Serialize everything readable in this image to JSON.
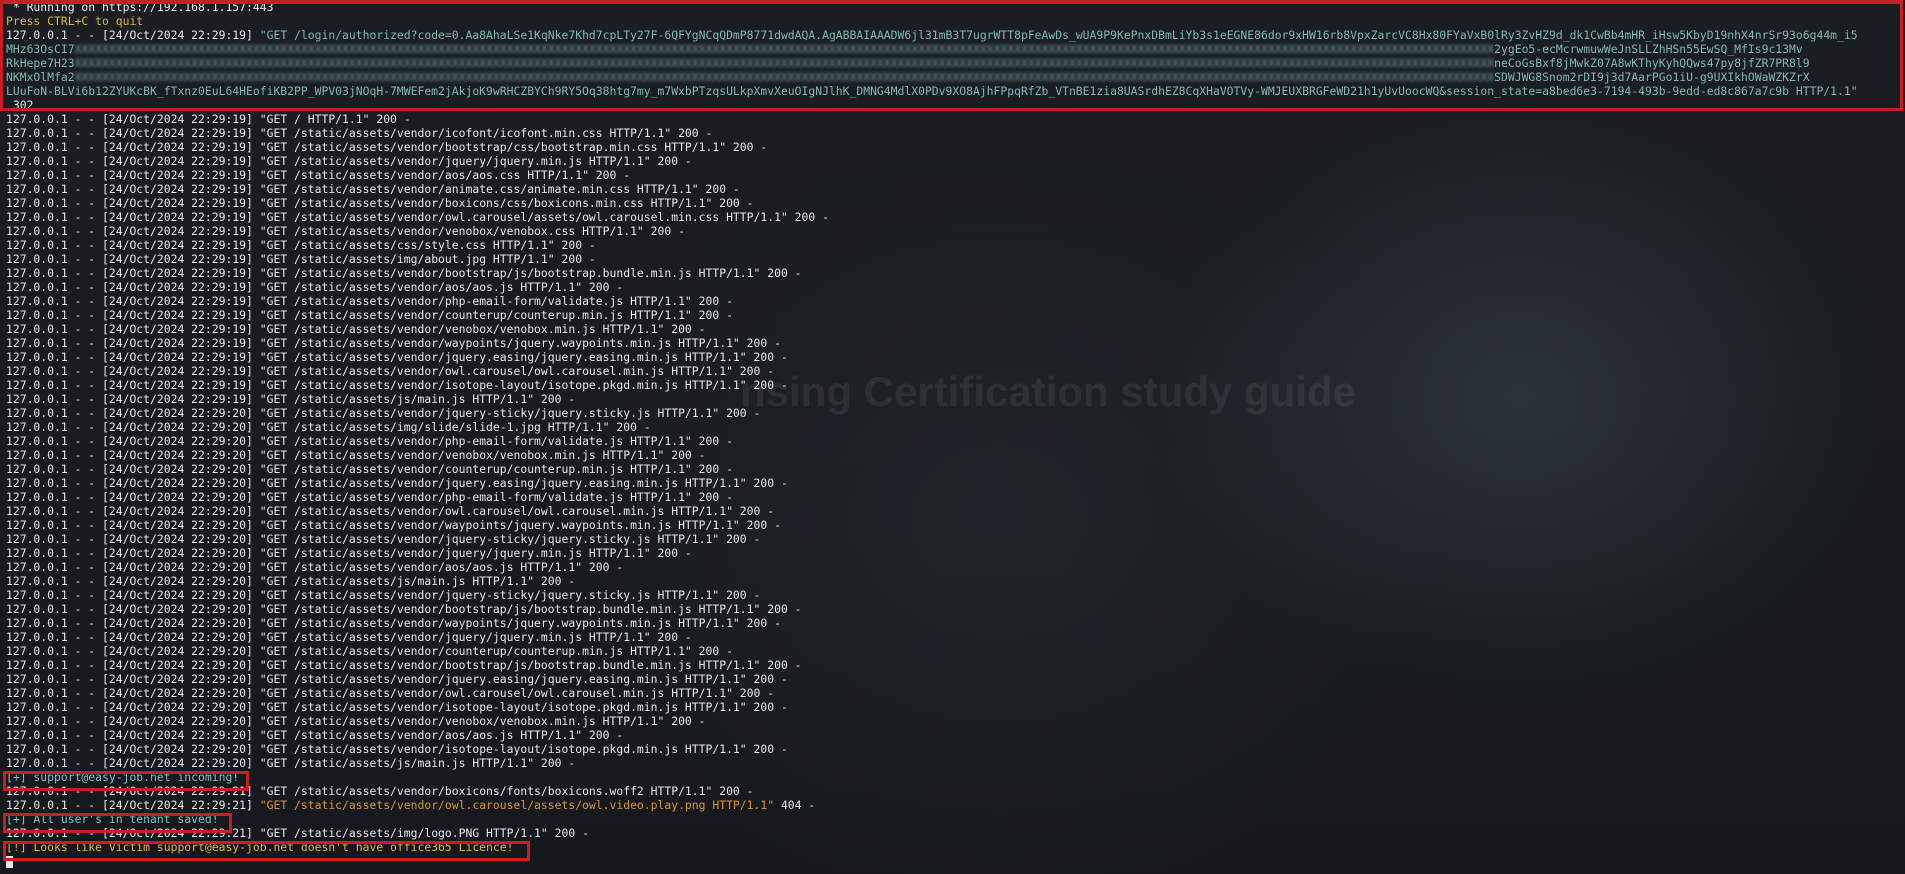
{
  "header": {
    "running": " * Running on https://192.168.1.157:443",
    "quit_hint": "Press CTRL+C to quit"
  },
  "auth_request": {
    "prefix": "127.0.0.1 - - [24/Oct/2024 22:29:19] ",
    "line1": "\"GET /login/authorized?code=0.Aa8AhaLSe1KqNke7Khd7cpLTy27F-6QFYgNCqQDmP8771dwdAQA.AgABBAIAAADW6jl31mB3T7ugrWTT8pFeAwDs_wUA9P9KePnxDBmLiYb3s1eEGNE86dor9xHW16rb8VpxZarcVC8Hx80FYaVxB0lRy3ZvHZ9d_dk1CwBb4mHR_iHsw5KbyD19nhX4nrSr93o6g44m_i5",
    "line2_start": "MHz63OsCI7",
    "line2_end": "2ygEo5-ecMcrwmuwWeJnSLLZhHSn55EwSQ_MfIs9c13Mv",
    "line3_start": "RkHepe7H23",
    "line3_end": "neCoGsBxf8jMwkZ07A8wKThyKyhQQws47py8jfZR7PR8l9",
    "line4_start": "NKMxOlMfa2",
    "line4_end": "SDWJWG8Snom2rDI9j3d7AarPGo1iU-g9UXIkhOWaWZKZrX",
    "line5": "LUuFoN-BLVi6b12ZYUKcBK_fTxnz0EuL64HEofiKB2PP_WPV03jNOqH-7MWEFem2jAkjoK9wRHCZBYCh9RY5Oq38htg7my_m7WxbPTzqsULkpXmvXeuOIgNJlhK_DMNG4MdlX0PDv9XO8AjhFPpqRfZb_VTnBE1zia8UASrdhEZ8CqXHaVOTVy-WMJEUXBRGFeWD21h1yUvUoocWQ&session_state=a8bed6e3-7194-493b-9edd-ed8c867a7c9b HTTP/1.1\"",
    "status": " 302"
  },
  "log_prefix_19": "127.0.0.1 - - [24/Oct/2024 22:29:19] ",
  "log_prefix_20": "127.0.0.1 - - [24/Oct/2024 22:29:20] ",
  "log_prefix_21": "127.0.0.1 - - [24/Oct/2024 22:29:21] ",
  "log_lines": [
    {
      "ts": "19",
      "req": "\"GET / HTTP/1.1\" 200 -"
    },
    {
      "ts": "19",
      "req": "\"GET /static/assets/vendor/icofont/icofont.min.css HTTP/1.1\" 200 -"
    },
    {
      "ts": "19",
      "req": "\"GET /static/assets/vendor/bootstrap/css/bootstrap.min.css HTTP/1.1\" 200 -"
    },
    {
      "ts": "19",
      "req": "\"GET /static/assets/vendor/jquery/jquery.min.js HTTP/1.1\" 200 -"
    },
    {
      "ts": "19",
      "req": "\"GET /static/assets/vendor/aos/aos.css HTTP/1.1\" 200 -"
    },
    {
      "ts": "19",
      "req": "\"GET /static/assets/vendor/animate.css/animate.min.css HTTP/1.1\" 200 -"
    },
    {
      "ts": "19",
      "req": "\"GET /static/assets/vendor/boxicons/css/boxicons.min.css HTTP/1.1\" 200 -"
    },
    {
      "ts": "19",
      "req": "\"GET /static/assets/vendor/owl.carousel/assets/owl.carousel.min.css HTTP/1.1\" 200 -"
    },
    {
      "ts": "19",
      "req": "\"GET /static/assets/vendor/venobox/venobox.css HTTP/1.1\" 200 -"
    },
    {
      "ts": "19",
      "req": "\"GET /static/assets/css/style.css HTTP/1.1\" 200 -"
    },
    {
      "ts": "19",
      "req": "\"GET /static/assets/img/about.jpg HTTP/1.1\" 200 -"
    },
    {
      "ts": "19",
      "req": "\"GET /static/assets/vendor/bootstrap/js/bootstrap.bundle.min.js HTTP/1.1\" 200 -"
    },
    {
      "ts": "19",
      "req": "\"GET /static/assets/vendor/aos/aos.js HTTP/1.1\" 200 -"
    },
    {
      "ts": "19",
      "req": "\"GET /static/assets/vendor/php-email-form/validate.js HTTP/1.1\" 200 -"
    },
    {
      "ts": "19",
      "req": "\"GET /static/assets/vendor/counterup/counterup.min.js HTTP/1.1\" 200 -"
    },
    {
      "ts": "19",
      "req": "\"GET /static/assets/vendor/venobox/venobox.min.js HTTP/1.1\" 200 -"
    },
    {
      "ts": "19",
      "req": "\"GET /static/assets/vendor/waypoints/jquery.waypoints.min.js HTTP/1.1\" 200 -"
    },
    {
      "ts": "19",
      "req": "\"GET /static/assets/vendor/jquery.easing/jquery.easing.min.js HTTP/1.1\" 200 -"
    },
    {
      "ts": "19",
      "req": "\"GET /static/assets/vendor/owl.carousel/owl.carousel.min.js HTTP/1.1\" 200 -"
    },
    {
      "ts": "19",
      "req": "\"GET /static/assets/vendor/isotope-layout/isotope.pkgd.min.js HTTP/1.1\" 200 -"
    },
    {
      "ts": "19",
      "req": "\"GET /static/assets/js/main.js HTTP/1.1\" 200 -"
    },
    {
      "ts": "20",
      "req": "\"GET /static/assets/vendor/jquery-sticky/jquery.sticky.js HTTP/1.1\" 200 -"
    },
    {
      "ts": "20",
      "req": "\"GET /static/assets/img/slide/slide-1.jpg HTTP/1.1\" 200 -"
    },
    {
      "ts": "20",
      "req": "\"GET /static/assets/vendor/php-email-form/validate.js HTTP/1.1\" 200 -"
    },
    {
      "ts": "20",
      "req": "\"GET /static/assets/vendor/venobox/venobox.min.js HTTP/1.1\" 200 -"
    },
    {
      "ts": "20",
      "req": "\"GET /static/assets/vendor/counterup/counterup.min.js HTTP/1.1\" 200 -"
    },
    {
      "ts": "20",
      "req": "\"GET /static/assets/vendor/jquery.easing/jquery.easing.min.js HTTP/1.1\" 200 -"
    },
    {
      "ts": "20",
      "req": "\"GET /static/assets/vendor/php-email-form/validate.js HTTP/1.1\" 200 -"
    },
    {
      "ts": "20",
      "req": "\"GET /static/assets/vendor/owl.carousel/owl.carousel.min.js HTTP/1.1\" 200 -"
    },
    {
      "ts": "20",
      "req": "\"GET /static/assets/vendor/waypoints/jquery.waypoints.min.js HTTP/1.1\" 200 -"
    },
    {
      "ts": "20",
      "req": "\"GET /static/assets/vendor/jquery-sticky/jquery.sticky.js HTTP/1.1\" 200 -"
    },
    {
      "ts": "20",
      "req": "\"GET /static/assets/vendor/jquery/jquery.min.js HTTP/1.1\" 200 -"
    },
    {
      "ts": "20",
      "req": "\"GET /static/assets/vendor/aos/aos.js HTTP/1.1\" 200 -"
    },
    {
      "ts": "20",
      "req": "\"GET /static/assets/js/main.js HTTP/1.1\" 200 -"
    },
    {
      "ts": "20",
      "req": "\"GET /static/assets/vendor/jquery-sticky/jquery.sticky.js HTTP/1.1\" 200 -"
    },
    {
      "ts": "20",
      "req": "\"GET /static/assets/vendor/bootstrap/js/bootstrap.bundle.min.js HTTP/1.1\" 200 -"
    },
    {
      "ts": "20",
      "req": "\"GET /static/assets/vendor/waypoints/jquery.waypoints.min.js HTTP/1.1\" 200 -"
    },
    {
      "ts": "20",
      "req": "\"GET /static/assets/vendor/jquery/jquery.min.js HTTP/1.1\" 200 -"
    },
    {
      "ts": "20",
      "req": "\"GET /static/assets/vendor/counterup/counterup.min.js HTTP/1.1\" 200 -"
    },
    {
      "ts": "20",
      "req": "\"GET /static/assets/vendor/bootstrap/js/bootstrap.bundle.min.js HTTP/1.1\" 200 -"
    },
    {
      "ts": "20",
      "req": "\"GET /static/assets/vendor/jquery.easing/jquery.easing.min.js HTTP/1.1\" 200 -"
    },
    {
      "ts": "20",
      "req": "\"GET /static/assets/vendor/owl.carousel/owl.carousel.min.js HTTP/1.1\" 200 -"
    },
    {
      "ts": "20",
      "req": "\"GET /static/assets/vendor/isotope-layout/isotope.pkgd.min.js HTTP/1.1\" 200 -"
    },
    {
      "ts": "20",
      "req": "\"GET /static/assets/vendor/venobox/venobox.min.js HTTP/1.1\" 200 -"
    },
    {
      "ts": "20",
      "req": "\"GET /static/assets/vendor/aos/aos.js HTTP/1.1\" 200 -"
    },
    {
      "ts": "20",
      "req": "\"GET /static/assets/vendor/isotope-layout/isotope.pkgd.min.js HTTP/1.1\" 200 -"
    },
    {
      "ts": "20",
      "req": "\"GET /static/assets/js/main.js HTTP/1.1\" 200 -"
    }
  ],
  "incoming": "[+] support@easy-job.net incoming!",
  "fonts_request": "\"GET /static/assets/vendor/boxicons/fonts/boxicons.woff2 HTTP/1.1\" 200 -",
  "video_request": "\"GET /static/assets/vendor/owl.carousel/assets/owl.video.play.png HTTP/1.1\"",
  "video_status": " 404 -",
  "saved": "[+] All user's in tenant saved!",
  "logo_request": "\"GET /static/assets/img/logo.PNG HTTP/1.1\" 200 -",
  "warning": "[!] Looks like Victim support@easy-job.net doesn't have office365 Licence!",
  "background": {
    "title": "nsing Certification study guide"
  },
  "colors": {
    "background": "#161a1f",
    "highlight_box": "#c81d25",
    "teal": "#79c3c0",
    "yellow": "#e0b43c",
    "orange": "#d9943a"
  }
}
